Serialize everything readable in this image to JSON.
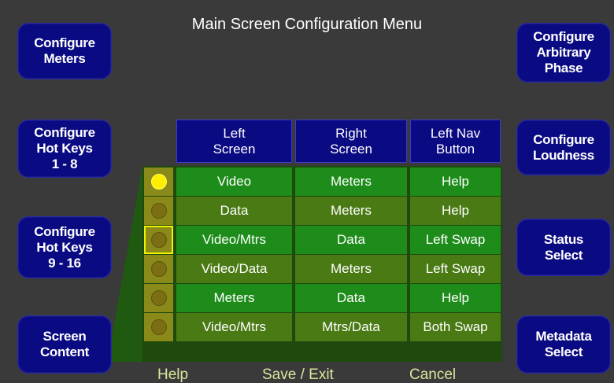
{
  "title": "Main Screen Configuration Menu",
  "left_buttons": {
    "configure_meters": "Configure\nMeters",
    "hot_keys_1_8": "Configure\nHot Keys\n1 - 8",
    "hot_keys_9_16": "Configure\nHot Keys\n9 - 16",
    "screen_content": "Screen\nContent"
  },
  "right_buttons": {
    "arbitrary_phase": "Configure\nArbitrary\nPhase",
    "loudness": "Configure\nLoudness",
    "status_select": "Status\nSelect",
    "metadata_select": "Metadata\nSelect"
  },
  "table": {
    "headers": {
      "left_screen": "Left\nScreen",
      "right_screen": "Right\nScreen",
      "left_nav": "Left Nav\nButton"
    },
    "rows": [
      {
        "left": "Video",
        "right": "Meters",
        "nav": "Help",
        "selected": true,
        "focused": false
      },
      {
        "left": "Data",
        "right": "Meters",
        "nav": "Help",
        "selected": false,
        "focused": false
      },
      {
        "left": "Video/Mtrs",
        "right": "Data",
        "nav": "Left Swap",
        "selected": false,
        "focused": true
      },
      {
        "left": "Video/Data",
        "right": "Meters",
        "nav": "Left Swap",
        "selected": false,
        "focused": false
      },
      {
        "left": "Meters",
        "right": "Data",
        "nav": "Help",
        "selected": false,
        "focused": false
      },
      {
        "left": "Video/Mtrs",
        "right": "Mtrs/Data",
        "nav": "Both Swap",
        "selected": false,
        "focused": false
      }
    ]
  },
  "bottom": {
    "help": "Help",
    "save_exit": "Save / Exit",
    "cancel": "Cancel"
  },
  "colors": {
    "background": "#3a3a3a",
    "button_blue": "#0a0a82",
    "cell_bright_green": "#1e8c1a",
    "cell_dark_green": "#4a7a14",
    "radio_on": "#ffee00",
    "focus_outline": "#f0f000",
    "bottom_text": "#d8e89c"
  }
}
